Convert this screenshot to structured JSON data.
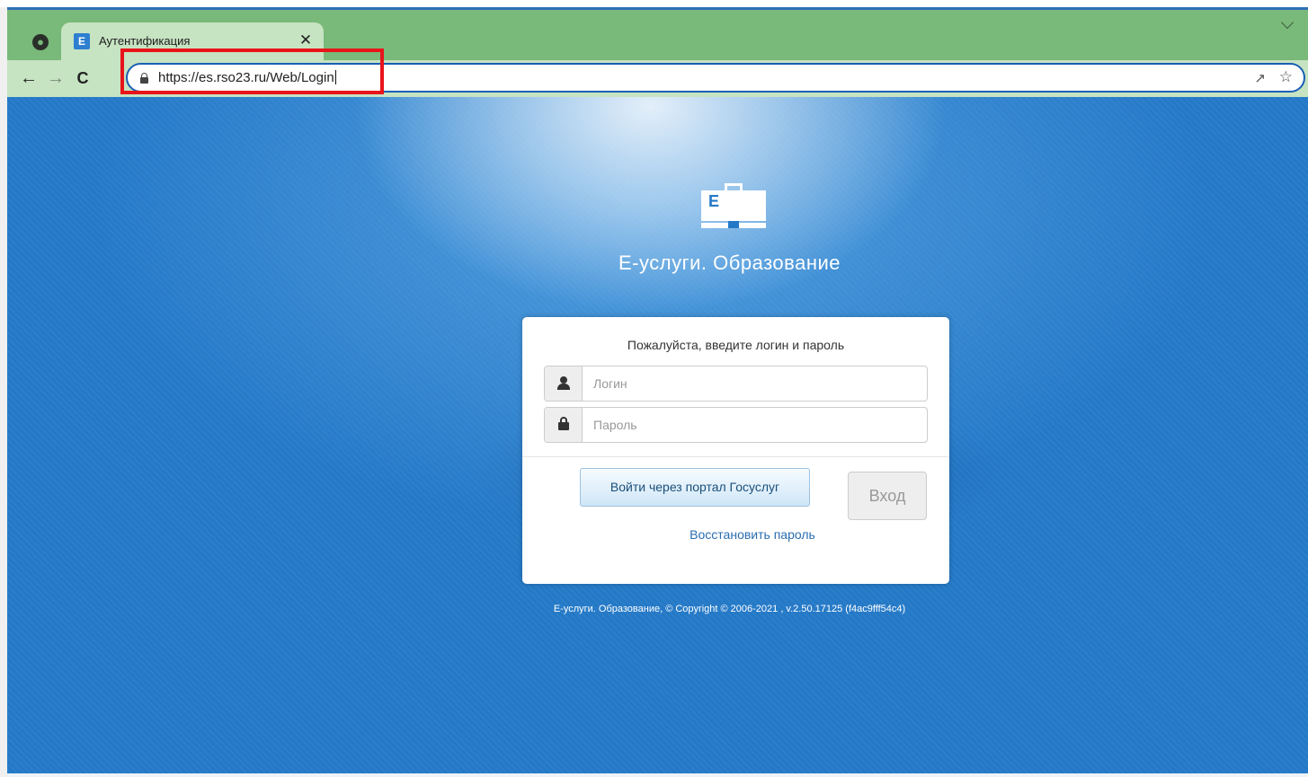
{
  "browser": {
    "tab": {
      "title": "Аутентификация",
      "favicon_letter": "E"
    },
    "address_bar": {
      "url": "https://es.rso23.ru/Web/Login"
    },
    "icons": {
      "globe": "globe-icon",
      "close": "close-icon",
      "back": "back-arrow-icon",
      "forward": "forward-arrow-icon",
      "reload": "reload-icon",
      "lock": "lock-icon",
      "share": "share-icon",
      "bookmark": "star-icon",
      "tabs_menu": "chevron-down-icon"
    },
    "highlight_color": "#e8141a"
  },
  "page": {
    "brand": {
      "logo_letter": "E",
      "title": "Е-услуги. Образование"
    },
    "login_form": {
      "prompt": "Пожалуйста, введите логин и пароль",
      "login_placeholder": "Логин",
      "password_placeholder": "Пароль",
      "gosuslugi_button": "Войти через портал Госуслуг",
      "login_button": "Вход",
      "restore_link": "Восстановить пароль"
    },
    "footer": {
      "copyright": "Е-услуги. Образование, © Copyright © 2006-2021 , v.2.50.17125 (f4ac9fff54c4)"
    },
    "colors": {
      "background": "#2479c7",
      "link": "#2a6db0",
      "tab_strip": "#79b979",
      "toolbar": "#c6e3c2"
    }
  }
}
